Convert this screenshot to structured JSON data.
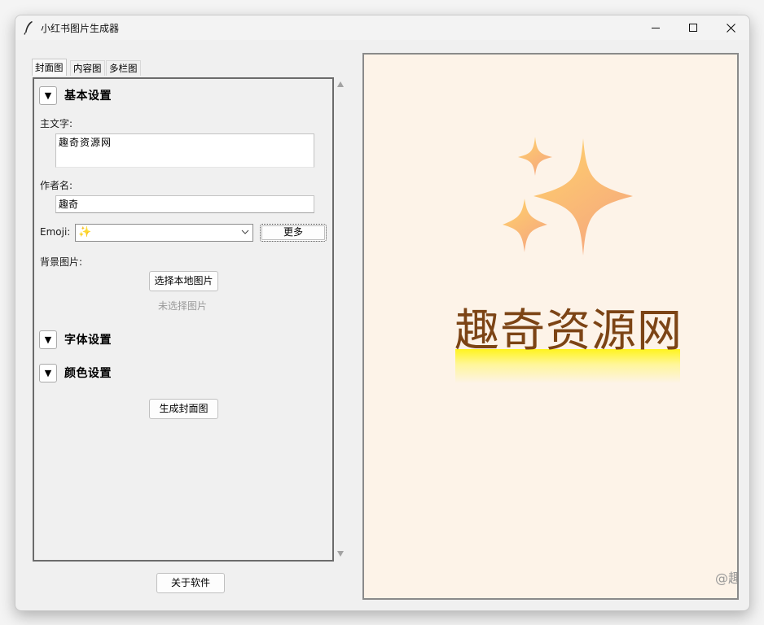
{
  "window": {
    "title": "小红书图片生成器",
    "icon": "feather-icon",
    "controls": [
      "minimize-icon",
      "maximize-icon",
      "close-icon"
    ]
  },
  "tabs": [
    {
      "label": "封面图",
      "active": true
    },
    {
      "label": "内容图",
      "active": false
    },
    {
      "label": "多栏图",
      "active": false
    }
  ],
  "sections": {
    "basic": {
      "toggle": "▼",
      "title": "基本设置"
    },
    "font": {
      "toggle": "▼",
      "title": "字体设置"
    },
    "color": {
      "toggle": "▼",
      "title": "颜色设置"
    }
  },
  "form": {
    "main_text_label": "主文字:",
    "main_text_value": "趣奇资源网",
    "author_label": "作者名:",
    "author_value": "趣奇",
    "emoji_label": "Emoji:",
    "emoji_value": "✨",
    "more_button": "更多",
    "bg_label": "背景图片:",
    "choose_button": "选择本地图片",
    "no_image_hint": "未选择图片",
    "generate_button": "生成封面图"
  },
  "about_button": "关于软件",
  "preview": {
    "emoji": "sparkles-icon",
    "title": "趣奇资源网",
    "watermark": "@趣",
    "background_color": "#fdf3e8",
    "text_color": "#7c4415",
    "highlight_color": "#fff41d"
  }
}
